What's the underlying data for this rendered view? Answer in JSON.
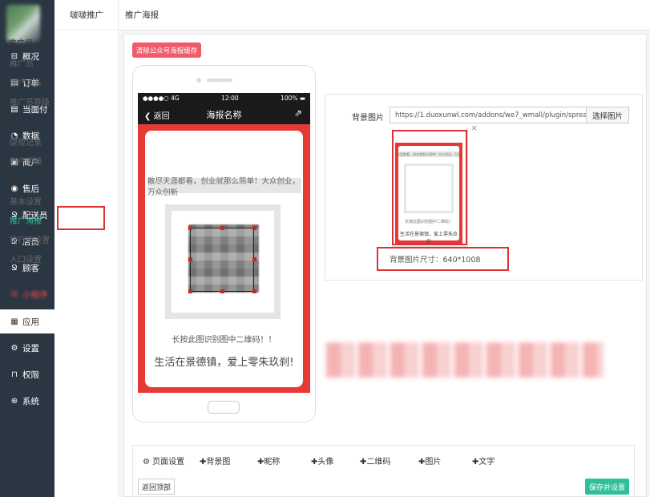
{
  "sidebar": {
    "items": [
      {
        "label": "概况",
        "icon": "overview-icon",
        "glyph": "⊟"
      },
      {
        "label": "订单",
        "icon": "order-icon",
        "glyph": "▤"
      },
      {
        "label": "当面付",
        "icon": "facepay-icon",
        "glyph": "▤"
      },
      {
        "label": "数据",
        "icon": "data-icon",
        "glyph": "◔"
      },
      {
        "label": "商户",
        "icon": "merchant-icon",
        "glyph": "▣"
      },
      {
        "label": "售后",
        "icon": "aftersale-icon",
        "glyph": "◉"
      },
      {
        "label": "配送员",
        "icon": "courier-icon",
        "glyph": "Ջ"
      },
      {
        "label": "店员",
        "icon": "clerk-icon",
        "glyph": "Ջ"
      },
      {
        "label": "顾客",
        "icon": "customer-icon",
        "glyph": "Ջ"
      },
      {
        "label": "小程序",
        "icon": "miniapp-icon",
        "glyph": "☒"
      },
      {
        "label": "应用",
        "icon": "apps-icon",
        "glyph": "▦"
      },
      {
        "label": "设置",
        "icon": "settings-icon",
        "glyph": "⚙"
      },
      {
        "label": "权限",
        "icon": "lock-icon",
        "glyph": "⊓"
      },
      {
        "label": "系统",
        "icon": "system-icon",
        "glyph": "⊕"
      }
    ]
  },
  "subnav": {
    "title": "啵啵推广",
    "groups": [
      {
        "title": "推广员",
        "items": [
          "推广员",
          "推广关系",
          "推广员等级"
        ]
      },
      {
        "title": "财务",
        "items": [
          "提现记录",
          "账户明细"
        ]
      },
      {
        "title": "设置",
        "items": [
          "基本设置",
          "推广海报",
          "排行榜设置",
          "入口设置"
        ]
      }
    ]
  },
  "header": {
    "title": "推广海报"
  },
  "actions": {
    "clear_cache": "清除公众号海报缓存"
  },
  "phone": {
    "carrier": "●●●●○ 4G",
    "time": "12:00",
    "battery": "100% ▬",
    "back": "返回",
    "title": "海报名称",
    "share_glyph": "⇗",
    "slogan": "散尽天涯都看，创业就那么简单！大众创业，万众创新",
    "hint": "长按此图识别图中二维码！！",
    "tagline": "生活在景德镇，爱上零朱玖刹!"
  },
  "background": {
    "label": "背景图片",
    "url": "https://1.duoxunwl.com/addons/we7_wmall/plugin/spread/static/in",
    "choose": "选择图片",
    "close": "×",
    "size_text": "背景图片尺寸：640*1008",
    "thumb_slogan": "散尽天涯都看，创业就那么简单！大众创业，万众创新",
    "thumb_hint": "长按此图识别图中二维码！",
    "thumb_tagline": "生活在景德镇，爱上零朱玖刹"
  },
  "toolbar": {
    "page_settings": "页面设置",
    "bg_image": "背景图",
    "nickname": "昵称",
    "avatar": "头像",
    "qrcode": "二维码",
    "image": "图片",
    "text": "文字",
    "back_top": "返回顶部",
    "save": "保存并设置"
  },
  "colors": {
    "accent_green": "#2fbf9a",
    "accent_red": "#e53935",
    "sidebar_bg": "#2b3643"
  }
}
